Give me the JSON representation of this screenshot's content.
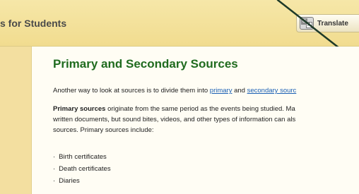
{
  "header": {
    "title": "s for Students",
    "translate_label": "Translate",
    "translate_icon": "translate-icon"
  },
  "main": {
    "heading": "Primary and Secondary Sources",
    "intro_before": "Another way to look at sources is to divide them into ",
    "intro_link_primary": "primary",
    "intro_and": " and ",
    "intro_link_secondary": "secondary sourc",
    "primary_term": "Primary sources",
    "primary_line1_rest": " originate from the same period as the events being studied. Ma",
    "primary_line2": "written documents, but sound bites, videos, and other types of information can als",
    "primary_line3": "sources. Primary sources include:",
    "list_items": [
      "Birth certificates",
      "Death certificates",
      "Diaries"
    ],
    "bullet": "·"
  },
  "colors": {
    "header_bg": "#f3e19b",
    "heading_green": "#1f6b1f",
    "link_blue": "#1a5fb4",
    "side_strip": "#f3dfa0",
    "content_bg": "#fffdf4"
  }
}
